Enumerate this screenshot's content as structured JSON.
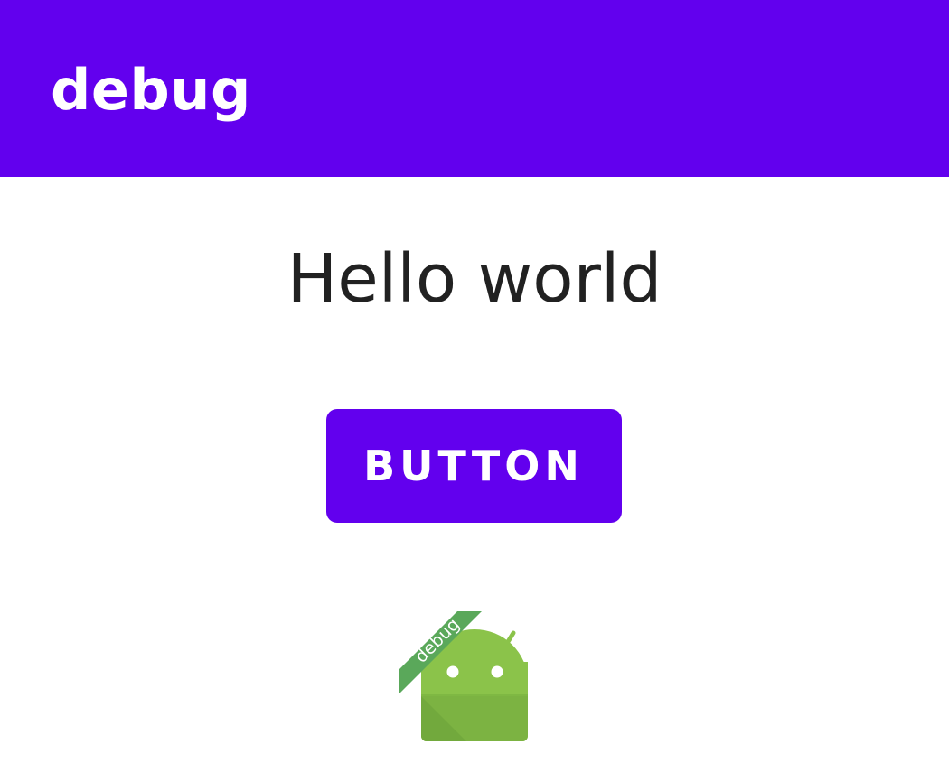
{
  "app_bar": {
    "title": "debug",
    "color": "#6200ee"
  },
  "main": {
    "greeting": "Hello world",
    "button_label": "BUTTON",
    "button_color": "#6200ee"
  },
  "launcher_icon": {
    "icon": "android-robot-icon",
    "ribbon_text": "debug",
    "ribbon_color": "#5aa85a",
    "robot_color": "#8bc34a"
  }
}
